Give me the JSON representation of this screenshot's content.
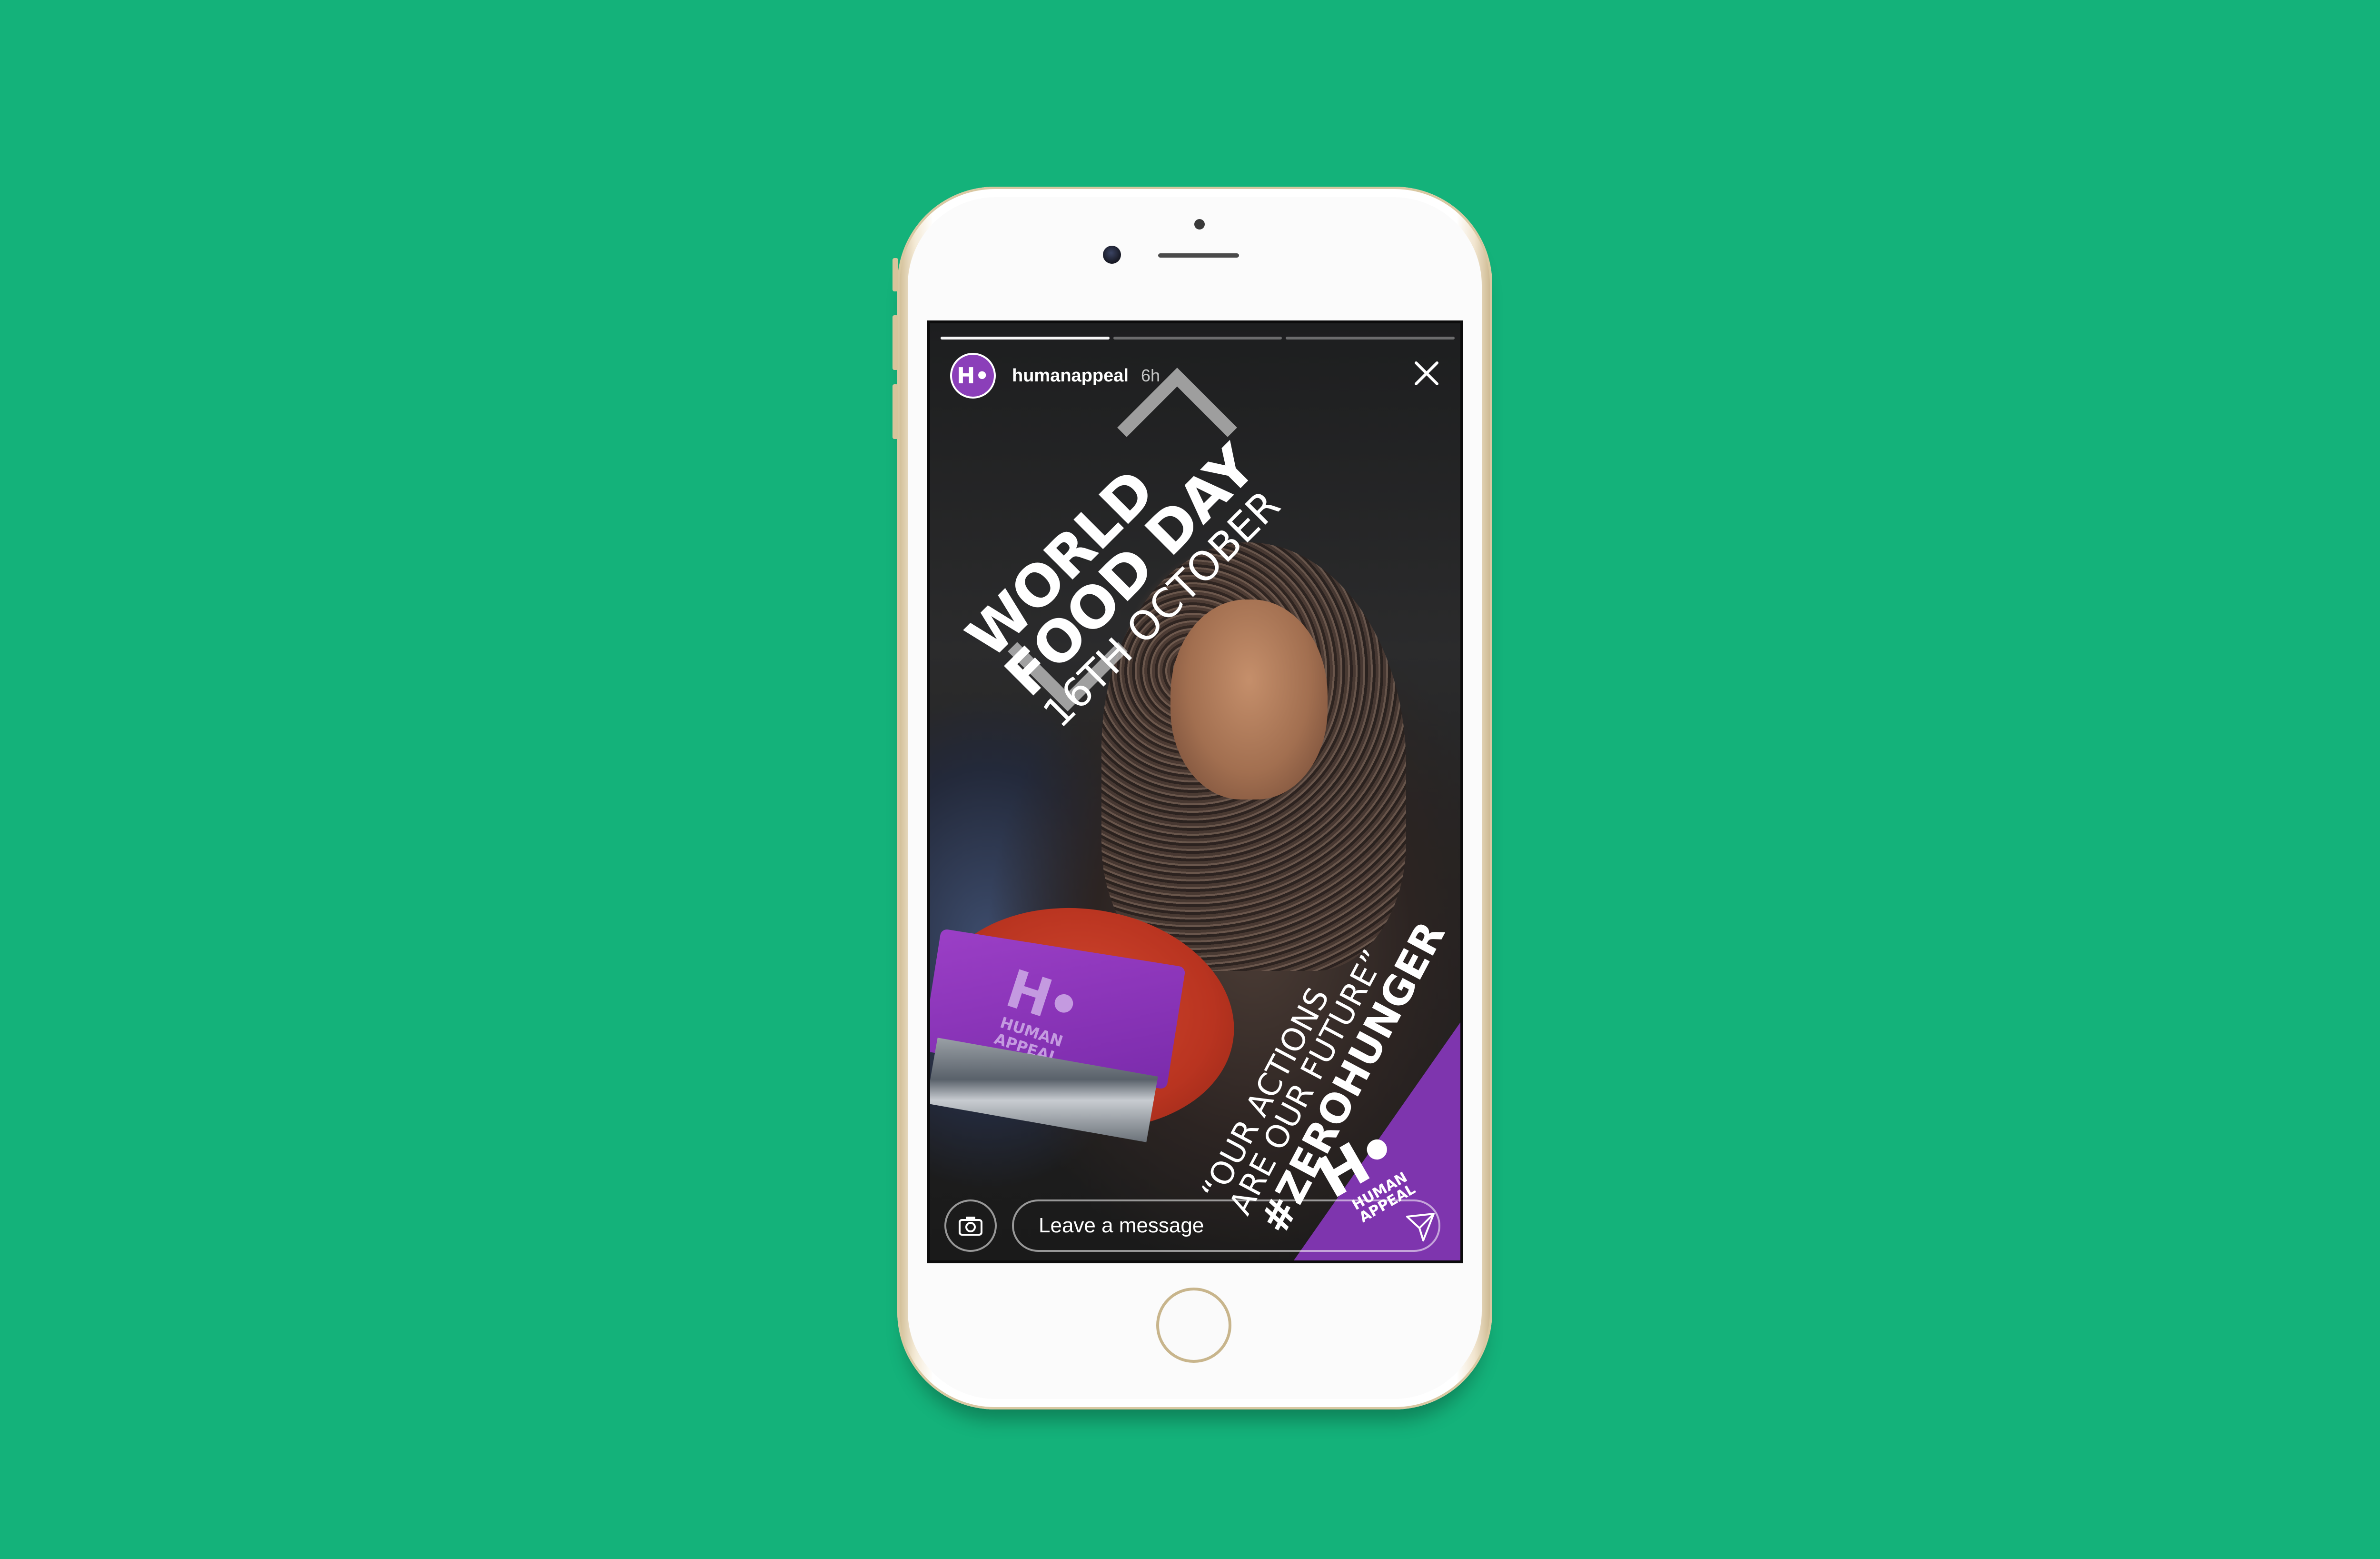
{
  "colors": {
    "background": "#14b27a",
    "brand_purple": "#7e35ae",
    "phone_gold": "#d9c8a2"
  },
  "story": {
    "progress_segments": [
      1.0,
      0.0,
      0.0
    ],
    "username": "humanappeal",
    "time_ago": "6h",
    "close_icon": "close-icon"
  },
  "post": {
    "title_lines": [
      "WORLD",
      "FOOD DAY"
    ],
    "date": "16TH OCTOBER",
    "quote_lines": [
      "“OUR ACTIONS",
      "ARE OUR FUTURE”"
    ],
    "hashtag": "#ZEROHUNGER",
    "logo_mark": "H•",
    "logo_text_lines": [
      "HUMAN",
      "APPEAL"
    ]
  },
  "reply_bar": {
    "camera_icon": "camera-icon",
    "placeholder": "Leave a message",
    "send_icon": "send-icon"
  }
}
